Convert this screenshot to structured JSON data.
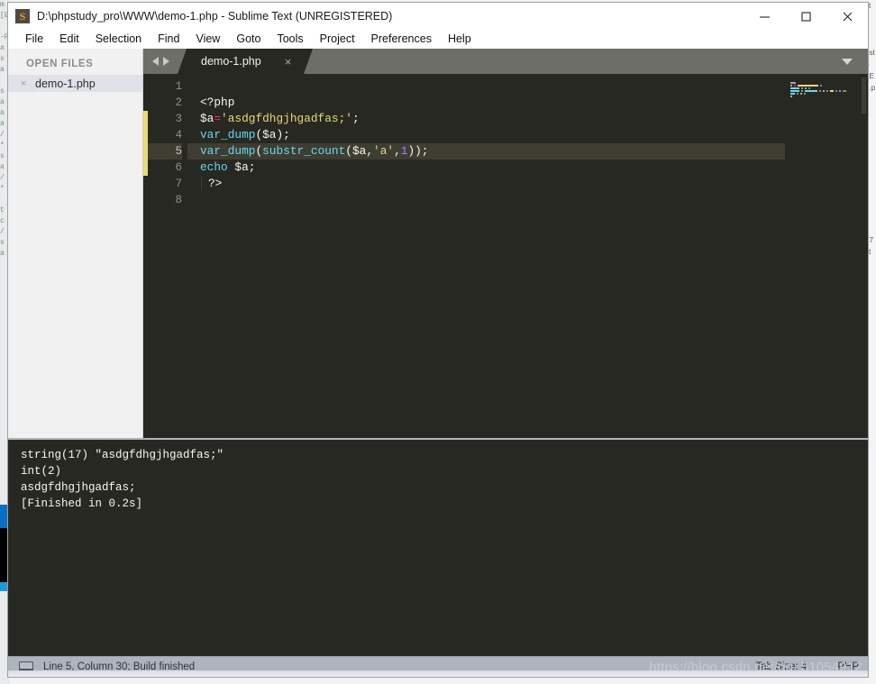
{
  "window": {
    "title": "D:\\phpstudy_pro\\WWW\\demo-1.php - Sublime Text (UNREGISTERED)",
    "app_icon": "sublime-text-icon",
    "minimize_label": "—",
    "maximize_label": "□",
    "close_label": "✕"
  },
  "menu": {
    "items": [
      {
        "label": "File"
      },
      {
        "label": "Edit"
      },
      {
        "label": "Selection"
      },
      {
        "label": "Find"
      },
      {
        "label": "View"
      },
      {
        "label": "Goto"
      },
      {
        "label": "Tools"
      },
      {
        "label": "Project"
      },
      {
        "label": "Preferences"
      },
      {
        "label": "Help"
      }
    ]
  },
  "sidebar": {
    "heading": "OPEN FILES",
    "files": [
      {
        "name": "demo-1.php",
        "close_glyph": "×"
      }
    ]
  },
  "tabs": {
    "nav_prev": "prev-tab-arrow",
    "nav_next": "next-tab-arrow",
    "items": [
      {
        "label": "demo-1.php",
        "close_glyph": "×",
        "active": true
      }
    ],
    "dropdown": "tab-list-dropdown"
  },
  "editor": {
    "line_numbers": [
      "1",
      "2",
      "3",
      "4",
      "5",
      "6",
      "7",
      "8"
    ],
    "active_line": 5,
    "modified_lines": [
      3,
      4,
      5,
      6
    ],
    "lines": [
      {
        "n": 1,
        "tokens": []
      },
      {
        "n": 2,
        "tokens": [
          {
            "t": "<?php",
            "c": "k-tag"
          }
        ]
      },
      {
        "n": 3,
        "tokens": [
          {
            "t": "$a",
            "c": "k-var"
          },
          {
            "t": "=",
            "c": "k-op"
          },
          {
            "t": "'asdgfdhgjhgadfas;'",
            "c": "k-str"
          },
          {
            "t": ";",
            "c": "k-punc"
          }
        ]
      },
      {
        "n": 4,
        "tokens": [
          {
            "t": "var_dump",
            "c": "k-fn"
          },
          {
            "t": "(",
            "c": "k-punc"
          },
          {
            "t": "$a",
            "c": "k-var"
          },
          {
            "t": ");",
            "c": "k-punc"
          }
        ]
      },
      {
        "n": 5,
        "tokens": [
          {
            "t": "var_dump",
            "c": "k-fn"
          },
          {
            "t": "(",
            "c": "k-punc"
          },
          {
            "t": "substr_count",
            "c": "k-fn"
          },
          {
            "t": "(",
            "c": "k-punc"
          },
          {
            "t": "$a",
            "c": "k-var"
          },
          {
            "t": ",",
            "c": "k-punc"
          },
          {
            "t": "'a'",
            "c": "k-str"
          },
          {
            "t": ",",
            "c": "k-punc"
          },
          {
            "t": "1",
            "c": "k-num"
          },
          {
            "t": "));",
            "c": "k-punc"
          }
        ]
      },
      {
        "n": 6,
        "tokens": [
          {
            "t": "echo",
            "c": "k-kw"
          },
          {
            "t": " ",
            "c": "k-punc"
          },
          {
            "t": "$a",
            "c": "k-var"
          },
          {
            "t": ";",
            "c": "k-punc"
          }
        ]
      },
      {
        "n": 7,
        "tokens": [
          {
            "t": "?>",
            "c": "k-tag"
          }
        ]
      },
      {
        "n": 8,
        "tokens": []
      }
    ],
    "code_plain": [
      "",
      "<?php",
      "$a='asdgfdhgjhgadfas;';",
      "var_dump($a);",
      "var_dump(substr_count($a,'a',1));",
      "echo $a;",
      "  ?>",
      ""
    ]
  },
  "console": {
    "output": "string(17) \"asdgfdhgjhgadfas;\"\nint(2)\nasdgfdhgjhgadfas;\n[Finished in 0.2s]",
    "lines": [
      "string(17) \"asdgfdhgjhgadfas;\"",
      "int(2)",
      "asdgfdhgjhgadfas;",
      "[Finished in 0.2s]"
    ]
  },
  "statusbar": {
    "icon": "console-panel-icon",
    "text": "Line 5, Column 30; Build finished",
    "tab_size": "Tab Size: 4",
    "syntax": "PHP",
    "watermark": "https://blog.csdn.net/qq_51054912"
  },
  "colors": {
    "editor_bg": "#272822",
    "active_line": "#3e3d32",
    "modified_marker": "#e6db74",
    "string": "#e6db74",
    "function": "#66d9ef",
    "operator": "#f92672",
    "number": "#ae81ff",
    "text": "#f8f8f2",
    "gutter_text": "#90918b",
    "tabbar_bg": "#6e6e68",
    "sidebar_bg": "#f1f1f1",
    "sidebar_selected": "#dfe3e9",
    "statusbar_bg": "#aeb4bd"
  },
  "background": {
    "left_strip_text": "m\n[E]\n\n-P\na\ns\na\n\ns\na\na\na\n/\n*\ns\na\n/\n*\n\nt\nc\n/\ns\na",
    "right_strip_text": "st\n:\n┐\n\nost\n$\nLE\n1.p\n\n\n\n\n\n\n\n\n\n\n\n\n17\nst"
  }
}
